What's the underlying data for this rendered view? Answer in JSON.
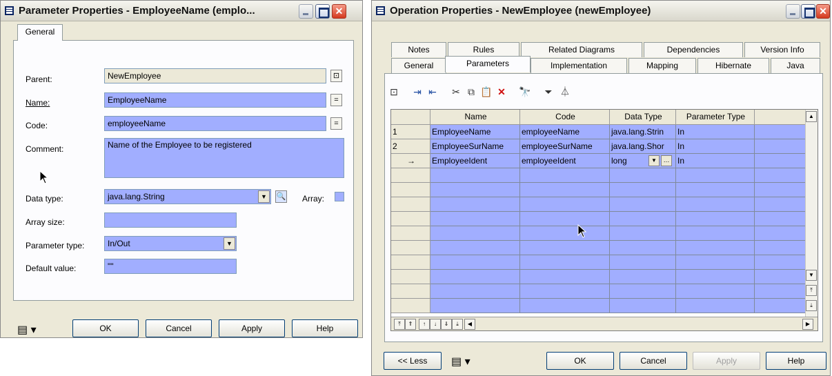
{
  "param_dialog": {
    "title": "Parameter Properties - EmployeeName (emplo...",
    "tab": "General",
    "labels": {
      "parent": "Parent:",
      "name": "Name:",
      "code": "Code:",
      "comment": "Comment:",
      "data_type": "Data type:",
      "array": "Array:",
      "array_size": "Array size:",
      "parameter_type": "Parameter type:",
      "default_value": "Default value:"
    },
    "values": {
      "parent": "NewEmployee",
      "name": "EmployeeName",
      "code": "employeeName",
      "comment": "Name of the Employee to be registered",
      "data_type": "java.lang.String",
      "array_size": "",
      "parameter_type": "In/Out",
      "default_value": "\"\""
    },
    "buttons": {
      "ok": "OK",
      "cancel": "Cancel",
      "apply": "Apply",
      "help": "Help"
    },
    "button_mini_eq": "=",
    "button_mini_eq2": "="
  },
  "op_dialog": {
    "title": "Operation Properties - NewEmployee (newEmployee)",
    "tabs_top": [
      "Notes",
      "Rules",
      "Related Diagrams",
      "Dependencies",
      "Version Info"
    ],
    "tabs_bottom": [
      "General",
      "Parameters",
      "Implementation",
      "Mapping",
      "Hibernate",
      "Java"
    ],
    "active_tab": "Parameters",
    "grid": {
      "columns": [
        "Name",
        "Code",
        "Data Type",
        "Parameter Type"
      ],
      "rows": [
        {
          "num": "1",
          "name": "EmployeeName",
          "code": "employeeName",
          "data_type": "java.lang.Strin",
          "ptype": "In"
        },
        {
          "num": "2",
          "name": "EmployeeSurName",
          "code": "employeeSurName",
          "data_type": "java.lang.Shor",
          "ptype": "In"
        },
        {
          "num": "→",
          "name": "EmployeeIdent",
          "code": "employeeIdent",
          "data_type": "long",
          "ptype": "In"
        }
      ],
      "empty_rows": 11
    },
    "buttons": {
      "less": "<< Less",
      "ok": "OK",
      "cancel": "Cancel",
      "apply": "Apply",
      "help": "Help"
    }
  }
}
